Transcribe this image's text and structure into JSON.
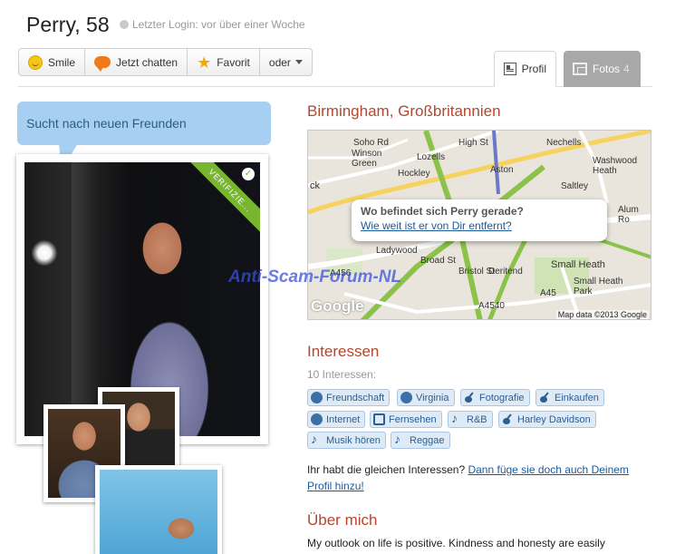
{
  "profile": {
    "name": "Perry, 58",
    "last_login": "Letzter Login: vor über einer Woche"
  },
  "actions": {
    "smile": "Smile",
    "chat": "Jetzt chatten",
    "favorite": "Favorit",
    "more": "oder"
  },
  "tabs": {
    "profil": "Profil",
    "fotos": "Fotos",
    "fotos_count": "4"
  },
  "status": "Sucht nach neuen Freunden",
  "verified_label": "VERIFIZIE...",
  "location": {
    "city": "Birmingham, Großbritannien",
    "map_question": "Wo befindet sich Perry gerade?",
    "map_link": "Wie weit ist er von Dir entfernt?",
    "map_credit": "Map data ©2013 Google",
    "map_logo": "Google",
    "labels": [
      "Soho Rd",
      "Winson Green",
      "Lozells",
      "Hockley",
      "Aston",
      "Nechells",
      "Washwood Heath",
      "Saltley",
      "Alum Ro",
      "Ladywood",
      "Deritend",
      "Small Heath",
      "Small Heath Park",
      "A456",
      "A4540",
      "A45",
      "Bristol St",
      "Broad St",
      "High St",
      "ck"
    ]
  },
  "watermark": "Anti-Scam-Forum-NL",
  "interests": {
    "heading": "Interessen",
    "count": "10 Interessen:",
    "items": [
      {
        "label": "Freundschaft",
        "icon": "friendship-icon"
      },
      {
        "label": "Virginia",
        "icon": "globe-icon"
      },
      {
        "label": "Fotografie",
        "icon": "guitar-icon"
      },
      {
        "label": "Einkaufen",
        "icon": "guitar-icon"
      },
      {
        "label": "Internet",
        "icon": "friendship-icon"
      },
      {
        "label": "Fernsehen",
        "icon": "tv-icon"
      },
      {
        "label": "R&B",
        "icon": "music-note-icon"
      },
      {
        "label": "Harley Davidson",
        "icon": "guitar-icon"
      },
      {
        "label": "Musik hören",
        "icon": "music-note-icon"
      },
      {
        "label": "Reggae",
        "icon": "music-note-icon"
      }
    ],
    "same_text": "Ihr habt die gleichen Interessen?",
    "same_link": "Dann füge sie doch auch Deinem Profil hinzu!"
  },
  "about": {
    "heading": "Über mich",
    "text": "My outlook on life is positive. Kindness and honesty are easily"
  },
  "colors": {
    "accent_heading": "#b5462c",
    "chip_bg": "#deebf7",
    "status_bubble": "#a7cff1",
    "verified_green": "#77b62e"
  }
}
